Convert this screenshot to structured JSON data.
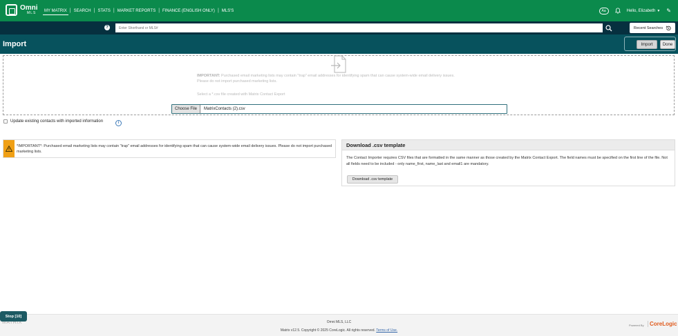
{
  "brand": {
    "name": "Omni",
    "sub": "MLS"
  },
  "nav": {
    "items": [
      {
        "label": "MY MATRIX",
        "active": true
      },
      {
        "label": "SEARCH",
        "active": false
      },
      {
        "label": "STATS",
        "active": false
      },
      {
        "label": "MARKET REPORTS",
        "active": false
      },
      {
        "label": "FINANCE (ENGLISH ONLY)",
        "active": false
      },
      {
        "label": "MLS'S",
        "active": false
      }
    ],
    "font_toggle": "Aa",
    "greeting": "Hello, Elizabeth",
    "bell_icon": "bell-icon",
    "edit_icon": "pencil-icon"
  },
  "search": {
    "help_label": "?",
    "placeholder": "Enter Shorthand or MLS#",
    "recent_label": "Recent Searches"
  },
  "page": {
    "title": "Import",
    "import_label": "Import",
    "done_label": "Done"
  },
  "dropzone": {
    "important_prefix": "IMPORTANT:",
    "important_text": " Purchased email marketing lists may contain \"trap\" email addresses for identifying spam that can cause system-wide email delivery issues.",
    "important_line2": "Please do not import purchased marketing lists.",
    "select_text": "Select a *.csv file created with Matrix Contact Export",
    "choose_label": "Choose File",
    "file_name": "MatrixContacts (2).csv"
  },
  "options": {
    "update_label": "Update existing contacts with imported information",
    "update_checked": false,
    "info_label": "i"
  },
  "warning": {
    "text": "*IMPORTANT*: Purchased email marketing lists may contain \"trap\" email addresses for identifying spam that can cause system-wide email delivery issues. Please do not import purchased marketing lists."
  },
  "template": {
    "heading": "Download .csv template",
    "body": "The Contact Importer requires CSV files that are formatted in the same manner as those created by the Matrix Contact Export. The field names must be specified on the first line of the file. Not all fields need to be included - only name_first, name_last and email1 are mandatory.",
    "button_label": "Download .csv template"
  },
  "footer": {
    "company": "Omni MLS, LLC",
    "copyright": "Matrix v12.5. Copyright © 2025 CoreLogic. All rights reserved.",
    "terms_label": "Terms of Use.",
    "matrix_word": "MATRIX",
    "powered_by": "Powered By",
    "corelogic": "CoreLogic",
    "stop_label": "Stop [10]"
  },
  "colors": {
    "nav_bg": "#0b8a4c",
    "search_bg": "#06303f",
    "title_bg": "#07525d",
    "warning_accent": "#f0a015"
  }
}
